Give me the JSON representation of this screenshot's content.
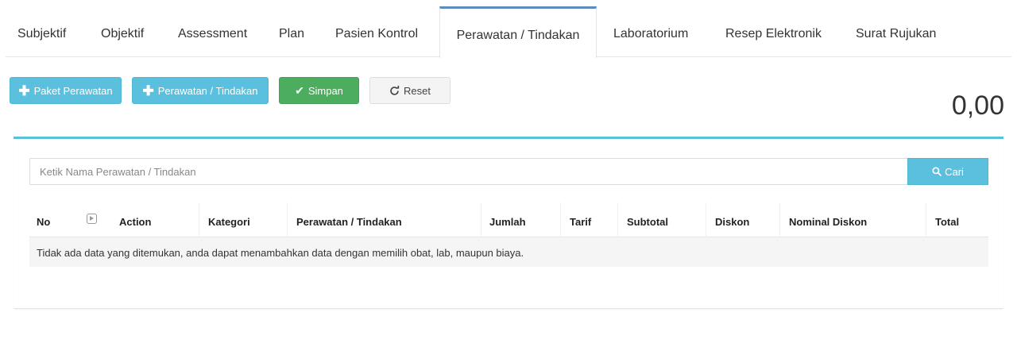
{
  "tabs": [
    {
      "label": "Subjektif"
    },
    {
      "label": "Objektif"
    },
    {
      "label": "Assessment"
    },
    {
      "label": "Plan"
    },
    {
      "label": "Pasien Kontrol"
    },
    {
      "label": "Perawatan / Tindakan",
      "active": true
    },
    {
      "label": "Laboratorium"
    },
    {
      "label": "Resep Elektronik"
    },
    {
      "label": "Surat Rujukan"
    }
  ],
  "toolbar": {
    "paket_label": "Paket Perawatan",
    "perawatan_label": "Perawatan / Tindakan",
    "simpan_label": "Simpan",
    "reset_label": "Reset"
  },
  "total_amount": "0,00",
  "search": {
    "placeholder": "Ketik Nama Perawatan / Tindakan",
    "button_label": "Cari"
  },
  "table": {
    "columns": [
      "No",
      "",
      "Action",
      "Kategori",
      "Perawatan / Tindakan",
      "Jumlah",
      "Tarif",
      "Subtotal",
      "Diskon",
      "Nominal Diskon",
      "Total"
    ],
    "empty_message": "Tidak ada data yang ditemukan, anda dapat menambahkan data dengan memilih obat, lab, maupun biaya."
  },
  "colors": {
    "info": "#5bc0de",
    "success": "#4cad5f",
    "tab_active_border": "#5b8cbf"
  }
}
